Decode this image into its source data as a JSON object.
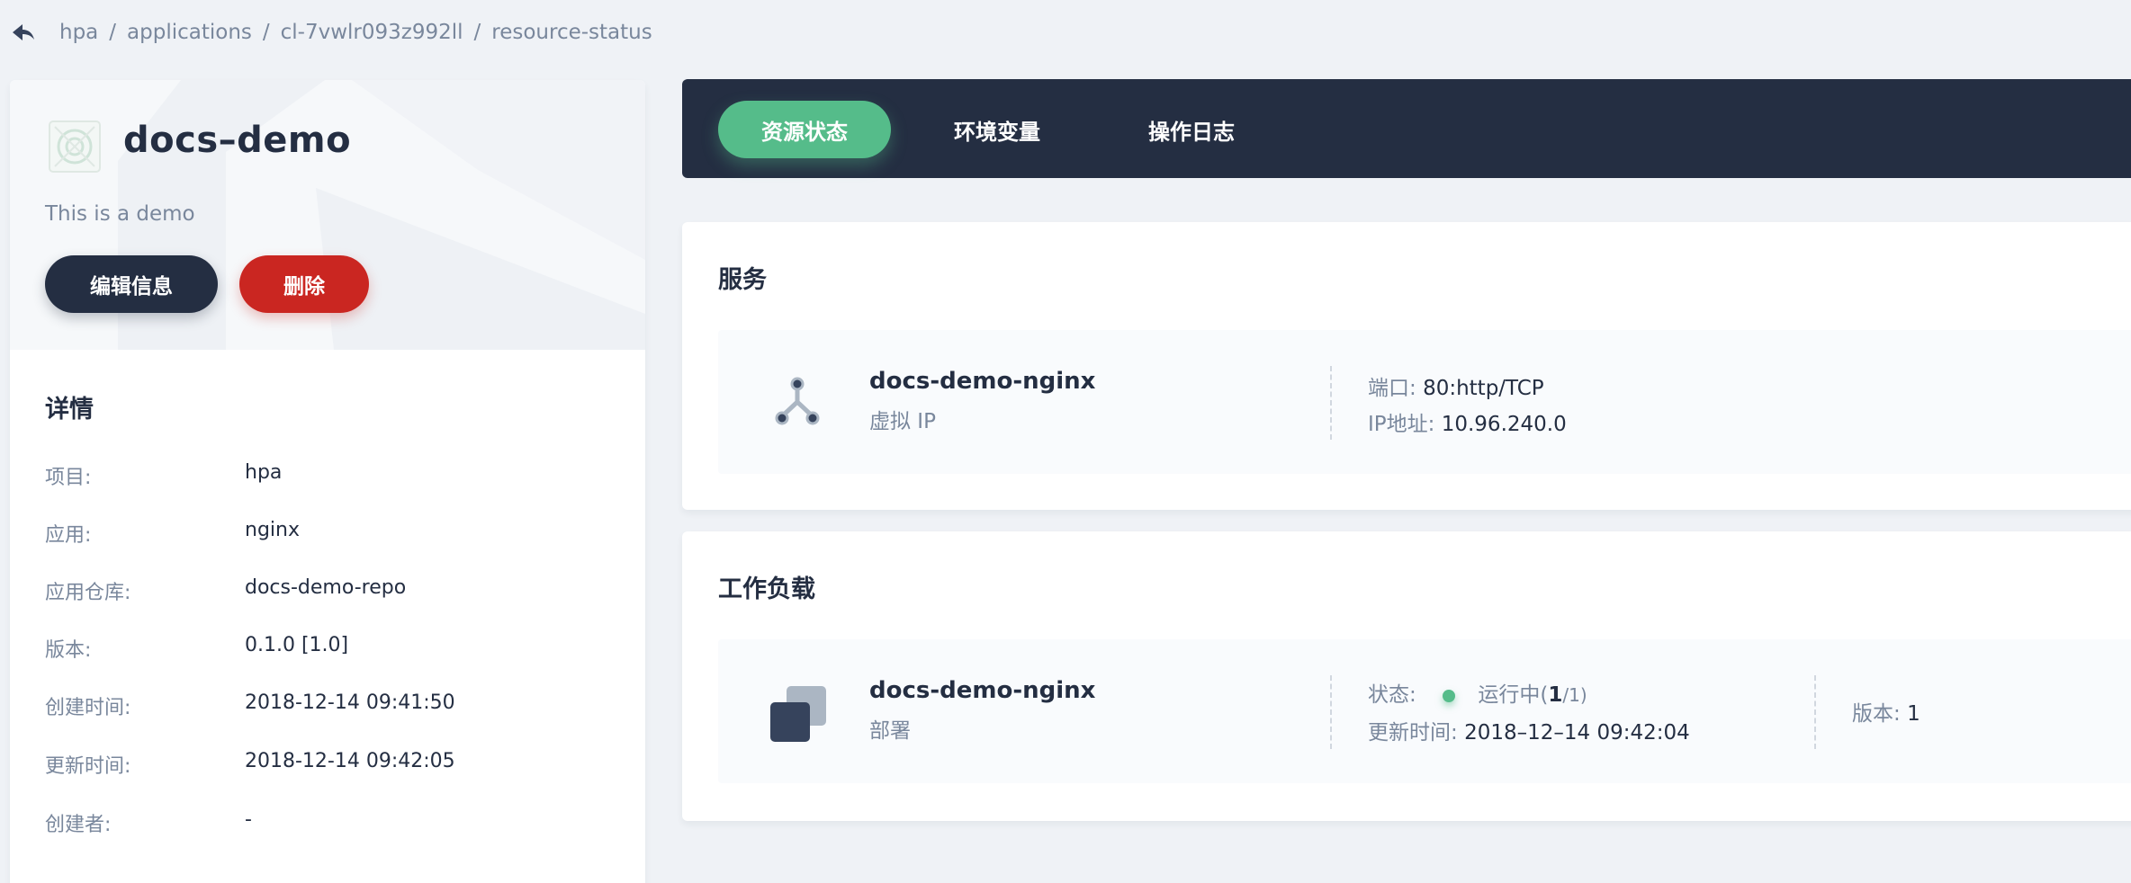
{
  "breadcrumb": {
    "items": [
      "hpa",
      "applications",
      "cl-7vwlr093z992ll",
      "resource-status"
    ],
    "separator": "/"
  },
  "app": {
    "name": "docs–demo",
    "description": "This is a demo",
    "edit_label": "编辑信息",
    "delete_label": "删除"
  },
  "details": {
    "title": "详情",
    "rows": [
      {
        "label": "项目:",
        "value": "hpa"
      },
      {
        "label": "应用:",
        "value": "nginx"
      },
      {
        "label": "应用仓库:",
        "value": "docs-demo-repo"
      },
      {
        "label": "版本:",
        "value": "0.1.0 [1.0]"
      },
      {
        "label": "创建时间:",
        "value": "2018-12-14 09:41:50"
      },
      {
        "label": "更新时间:",
        "value": "2018-12-14 09:42:05"
      },
      {
        "label": "创建者:",
        "value": "-"
      }
    ]
  },
  "tabs": [
    {
      "label": "资源状态",
      "active": true
    },
    {
      "label": "环境变量",
      "active": false
    },
    {
      "label": "操作日志",
      "active": false
    }
  ],
  "services": {
    "title": "服务",
    "item": {
      "name": "docs-demo-nginx",
      "type": "虚拟 IP",
      "port_label": "端口:",
      "port_value": "80:http/TCP",
      "ip_label": "IP地址:",
      "ip_value": "10.96.240.0",
      "icon": "service-icon"
    }
  },
  "workloads": {
    "title": "工作负载",
    "item": {
      "name": "docs-demo-nginx",
      "type": "部署",
      "status_label": "状态:",
      "status_text": "运行中(",
      "status_ready": "1",
      "status_total": "/1)",
      "updated_label": "更新时间:",
      "updated_value": "2018–12–14 09:42:04",
      "version_label": "版本:",
      "version_value": "1",
      "icon": "deployment-icon"
    }
  },
  "colors": {
    "dark": "#242e42",
    "green": "#55bc8a",
    "red": "#ca2621",
    "muted": "#79879c",
    "background": "#eff2f6"
  }
}
